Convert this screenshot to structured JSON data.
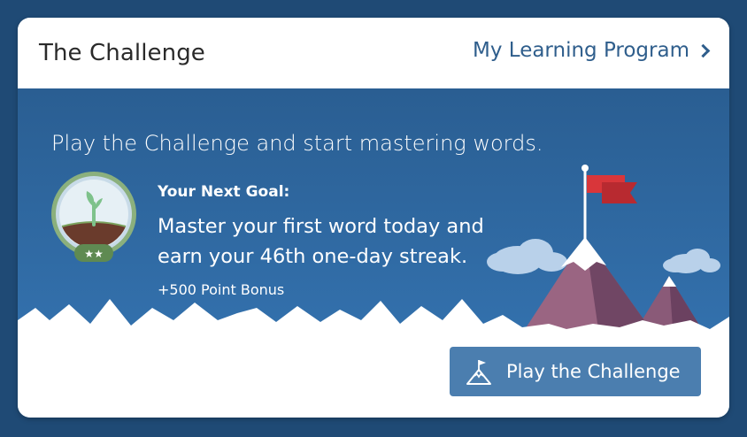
{
  "header": {
    "title": "The Challenge",
    "program_link": "My Learning Program"
  },
  "hero": {
    "tagline": "Play the Challenge and start mastering words.",
    "goal_label": "Your Next Goal:",
    "goal_text": "Master your first word today and earn your 46th one-day streak.",
    "bonus": "+500 Point Bonus",
    "badge_stars": "★★"
  },
  "actions": {
    "play_label": "Play the Challenge"
  },
  "icons": {
    "program_link": "chevron-right-icon",
    "badge": "sprout-badge-icon",
    "button": "mountain-flag-icon"
  },
  "colors": {
    "page_background": "#1f4a75",
    "hero_blue": "#3677b6",
    "link_blue": "#2f5e8c",
    "button_blue": "#4b7eaf",
    "flag_red": "#d9363a",
    "mountain_purple": "#8a5a78"
  }
}
